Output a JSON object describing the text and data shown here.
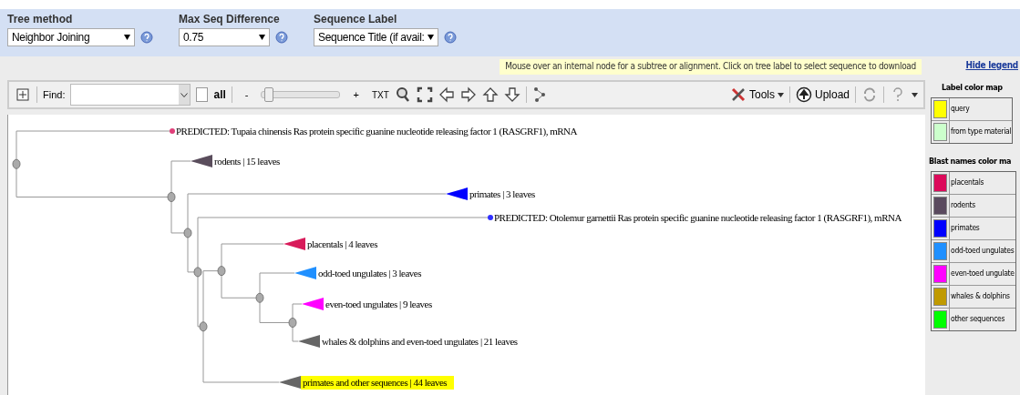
{
  "options": [
    {
      "label": "Tree method",
      "value": "Neighbor Joining"
    },
    {
      "label": "Max Seq Difference",
      "value": "0.75"
    },
    {
      "label": "Sequence Label",
      "value": "Sequence Title (if avail:"
    }
  ],
  "hint": "Mouse over an internal node for a subtree or alignment. Click on tree label to select sequence to download",
  "hide_legend": "Hide legend",
  "toolbar": {
    "find_label": "Find:",
    "all_label": "all",
    "all_checked": false,
    "zoom_minus": "-",
    "zoom_plus": "+",
    "zoom_slider": {
      "level": 0.03
    },
    "txt": "TXT",
    "tools": "Tools",
    "upload": "Upload"
  },
  "tree": {
    "children": [
      {
        "kind": "sequence",
        "label": "PREDICTED: Tupaia chinensis Ras protein specific guanine nucleotide releasing factor 1 (RASGRF1), mRNA",
        "color": "#e0407a",
        "highlighted": false
      },
      {
        "children": [
          {
            "kind": "collapsed",
            "label": "rodents | 15 leaves",
            "color": "#5a4d5c",
            "highlighted": false
          },
          {
            "children": [
              {
                "kind": "collapsed",
                "label": "primates | 3 leaves",
                "color": "#0000ff",
                "highlighted": false
              },
              {
                "children": [
                  {
                    "kind": "sequence",
                    "label": "PREDICTED: Otolemur garnettii Ras protein specific guanine nucleotide releasing factor 1 (RASGRF1), mRNA",
                    "color": "#3030ff",
                    "highlighted": false
                  },
                  {
                    "children": [
                      {
                        "children": [
                          {
                            "kind": "collapsed",
                            "label": "placentals | 4 leaves",
                            "color": "#d81b5a",
                            "highlighted": false
                          },
                          {
                            "children": [
                              {
                                "kind": "collapsed",
                                "label": "odd-toed ungulates | 3 leaves",
                                "color": "#2090ff",
                                "highlighted": false
                              },
                              {
                                "children": [
                                  {
                                    "kind": "collapsed",
                                    "label": "even-toed ungulates | 9 leaves",
                                    "color": "#ff00ff",
                                    "highlighted": false
                                  },
                                  {
                                    "kind": "collapsed",
                                    "label": "whales & dolphins and even-toed ungulates | 21 leaves",
                                    "color": "#666666",
                                    "highlighted": false
                                  }
                                ]
                              }
                            ]
                          }
                        ]
                      },
                      {
                        "kind": "collapsed",
                        "label": "primates and other sequences | 44 leaves",
                        "color": "#666666",
                        "highlighted": true
                      }
                    ]
                  }
                ]
              }
            ]
          }
        ]
      }
    ]
  },
  "legend": {
    "label_title": "Label color map",
    "label_items": [
      {
        "label": "query",
        "color": "#ffff00"
      },
      {
        "label": "from type material",
        "color": "#ccffcc"
      }
    ],
    "blast_title": "Blast names color ma",
    "blast_items": [
      {
        "label": "placentals",
        "color": "#dc0a5a"
      },
      {
        "label": "rodents",
        "color": "#5a4a5e"
      },
      {
        "label": "primates",
        "color": "#0000ff"
      },
      {
        "label": "odd-toed ungulates",
        "color": "#2090ff"
      },
      {
        "label": "even-toed ungulate",
        "color": "#ff00ff"
      },
      {
        "label": "whales & dolphins",
        "color": "#c09a00"
      },
      {
        "label": "other sequences",
        "color": "#00ff00"
      }
    ]
  }
}
